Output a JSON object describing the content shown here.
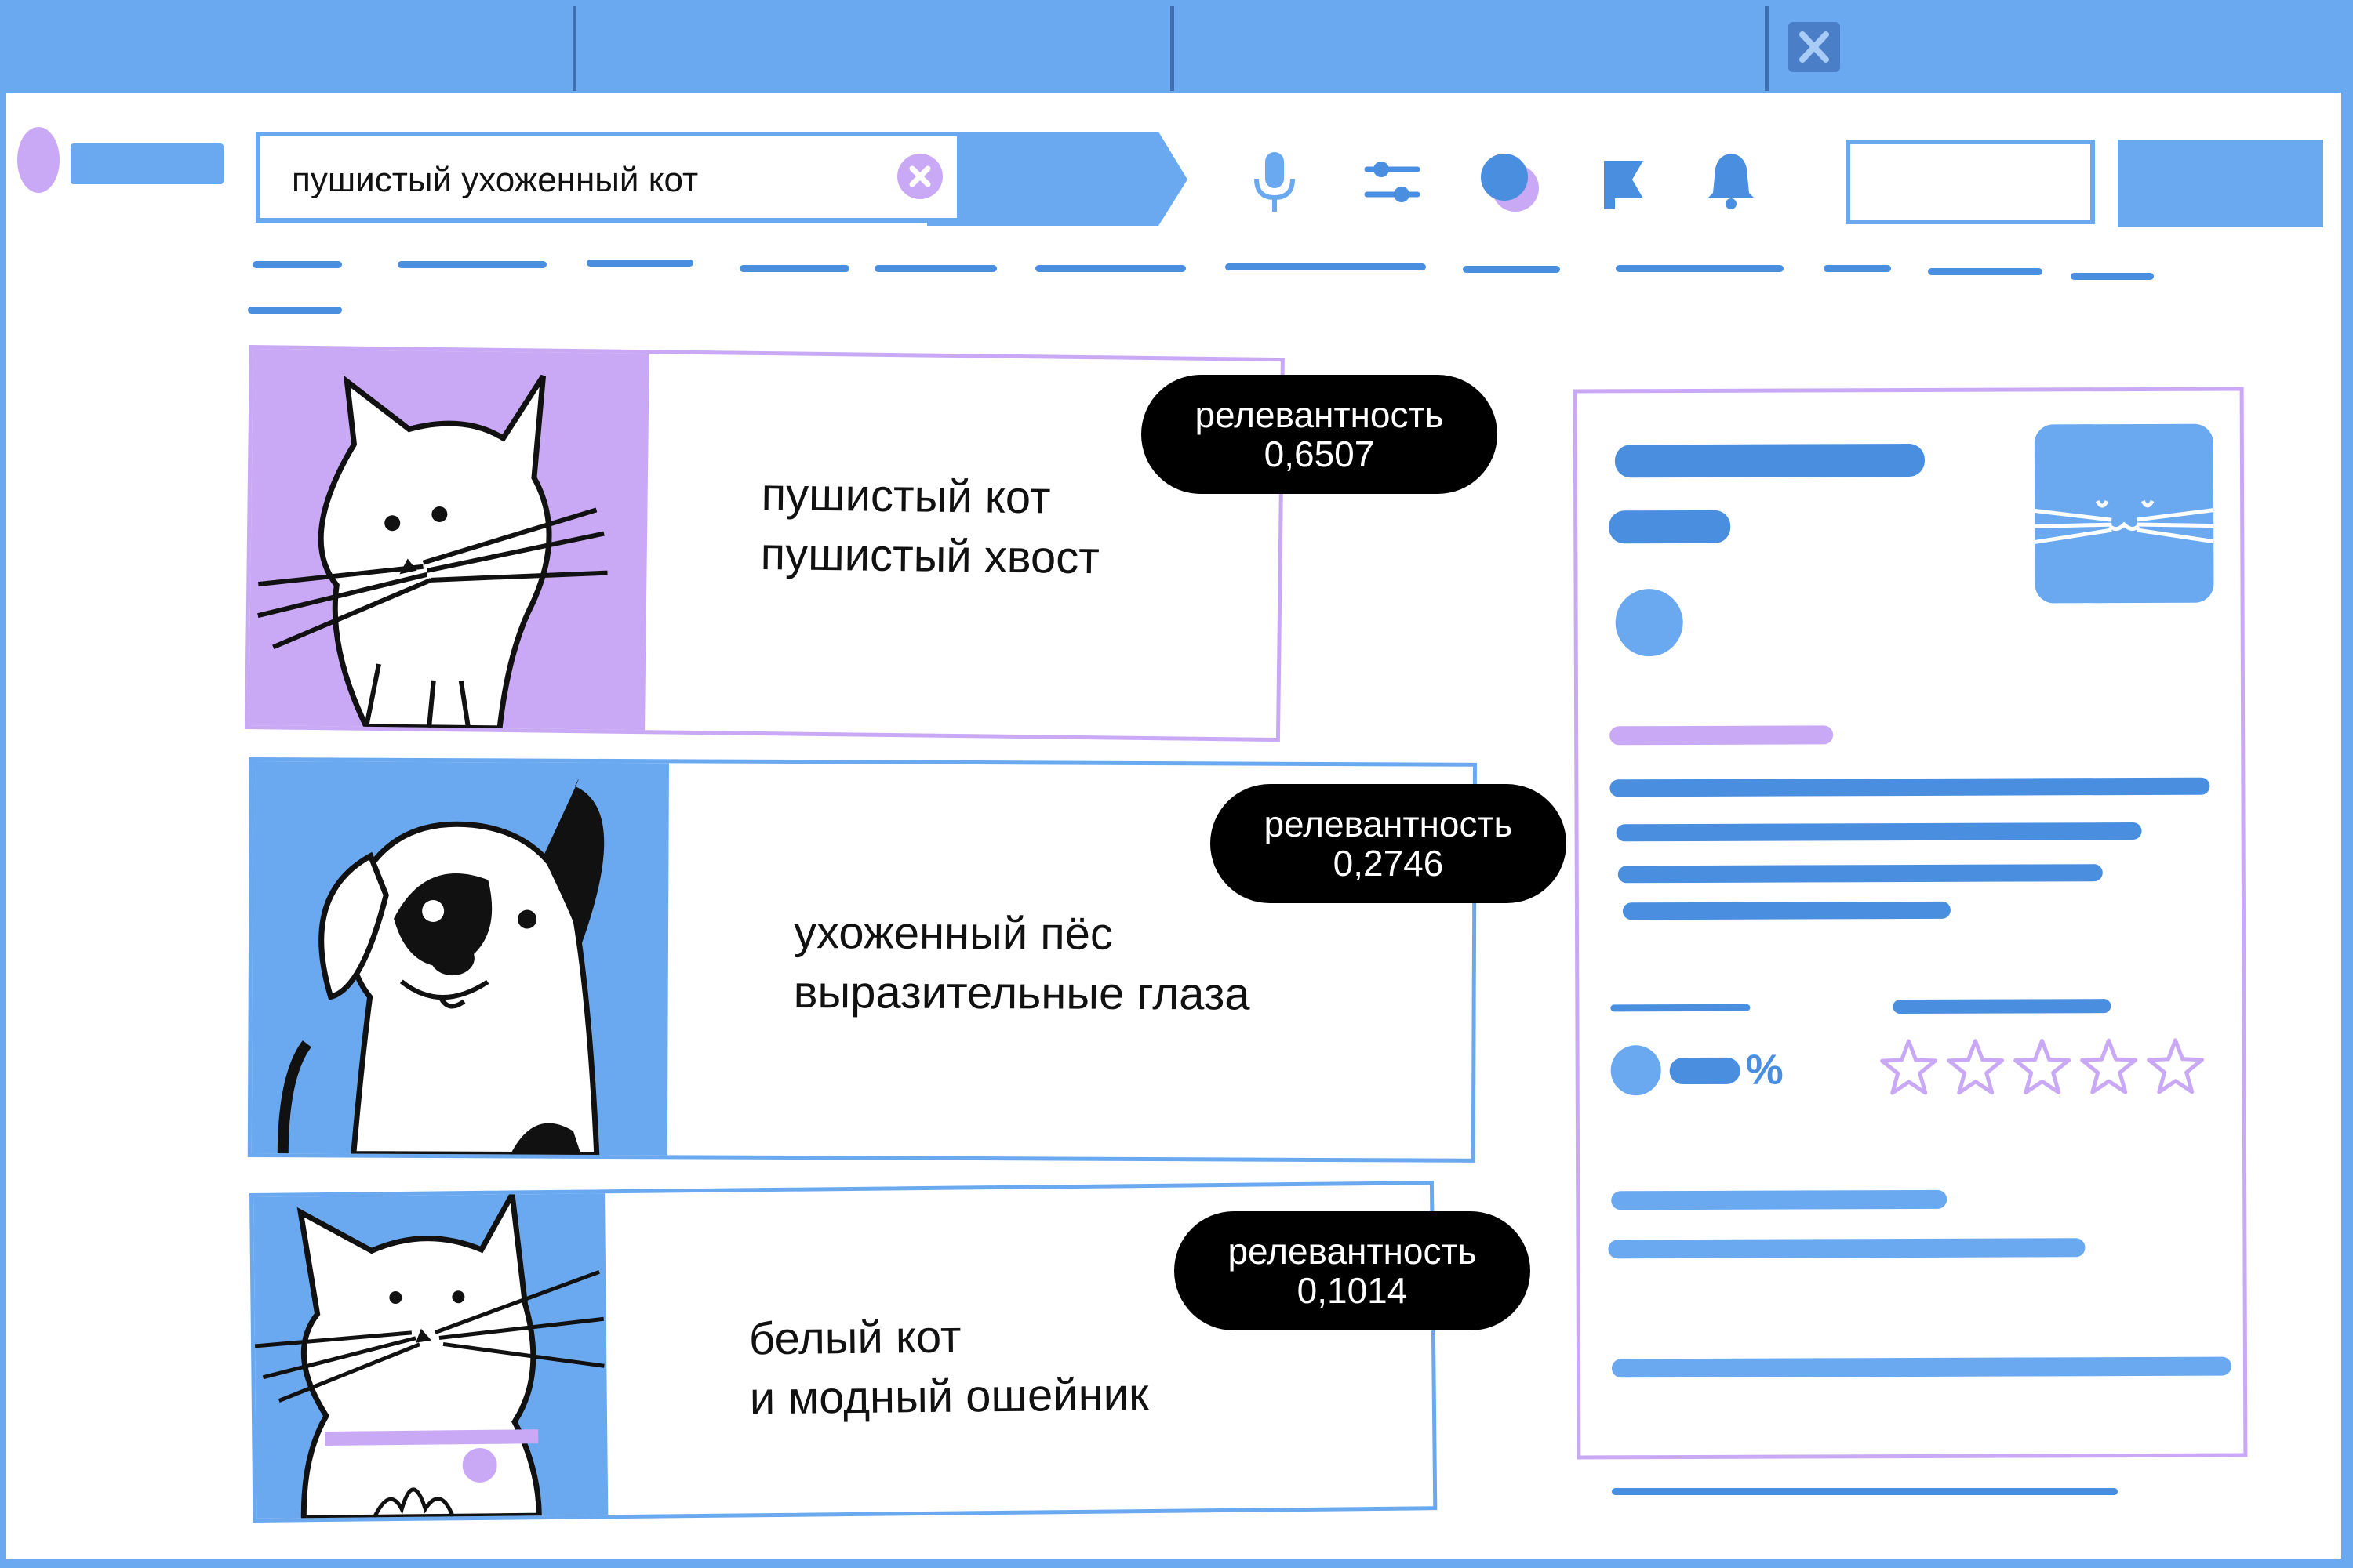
{
  "colors": {
    "window": "#ffffff",
    "chrome": "#6aa9f0",
    "accent": "#4a8ee0",
    "purple": "#c9a9f5",
    "badge": "#000000"
  },
  "search": {
    "query": "пушистый ухоженный кот"
  },
  "toolbar": {
    "icons": [
      "mic-icon",
      "filters-icon",
      "circles-icon",
      "flag-icon",
      "bell-icon"
    ]
  },
  "results": [
    {
      "text_line1": "пушистый кот",
      "text_line2": "пушистый хвост",
      "badge_label": "релевантность",
      "badge_value": "0,6507",
      "image": "white-cat-icon"
    },
    {
      "text_line1": "ухоженный пёс",
      "text_line2": "выразительные глаза",
      "badge_label": "релевантность",
      "badge_value": "0,2746",
      "image": "dog-icon"
    },
    {
      "text_line1": "белый кот",
      "text_line2": "и модный ошейник",
      "badge_label": "релевантность",
      "badge_value": "0,1014",
      "image": "fluffy-cat-icon"
    }
  ],
  "side_panel": {
    "percent_symbol": "%",
    "rating_stars": 5,
    "rating_filled": 0
  }
}
